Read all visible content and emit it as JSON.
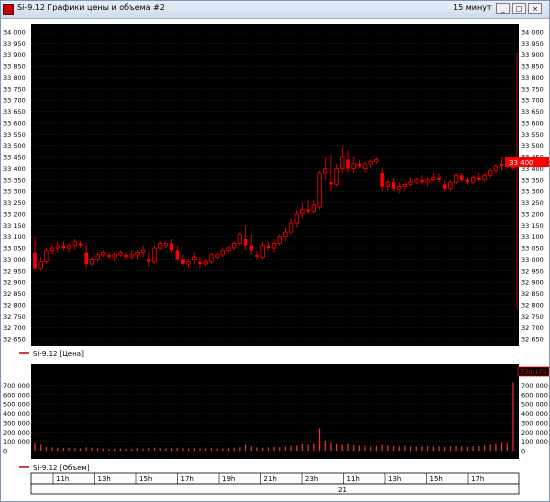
{
  "window": {
    "title": "Si-9.12 Графики цены и объема #2",
    "timeframe": "15 минут",
    "buttons": {
      "minimize": "_",
      "maximize": "□",
      "close": "×"
    }
  },
  "colors": {
    "background": "#000000",
    "candle": "#ff0000",
    "volume": "#ff3030",
    "grid": "#404040"
  },
  "legends": {
    "price": "Si-9.12 [Цена]",
    "volume": "Si-9.12 [Объем]"
  },
  "last_price_tag": "33 400",
  "last_volume_tag": "730 175",
  "time_axis": {
    "labels": [
      "11h",
      "13h",
      "15h",
      "17h",
      "19h",
      "21h",
      "23h",
      "11h",
      "13h",
      "15h",
      "17h"
    ],
    "date_label": "21"
  },
  "chart_data": [
    {
      "type": "candlestick",
      "series_name": "Si-9.12 [Цена]",
      "ylim": [
        32650,
        34000
      ],
      "y_ticks": [
        "34 000",
        "33 950",
        "33 900",
        "33 850",
        "33 800",
        "33 750",
        "33 700",
        "33 650",
        "33 600",
        "33 550",
        "33 500",
        "33 450",
        "33 400",
        "33 350",
        "33 300",
        "33 250",
        "33 200",
        "33 150",
        "33 100",
        "33 050",
        "33 000",
        "32 950",
        "32 900",
        "32 850",
        "32 800",
        "32 750",
        "32 700",
        "32 650"
      ],
      "ohlc": [
        [
          33030,
          33100,
          32955,
          32960
        ],
        [
          32960,
          33010,
          32950,
          32990
        ],
        [
          32990,
          33050,
          32980,
          33040
        ],
        [
          33040,
          33070,
          33020,
          33050
        ],
        [
          33050,
          33080,
          33030,
          33060
        ],
        [
          33060,
          33080,
          33040,
          33050
        ],
        [
          33050,
          33070,
          33030,
          33060
        ],
        [
          33060,
          33090,
          33040,
          33080
        ],
        [
          33070,
          33080,
          33050,
          33060
        ],
        [
          33030,
          33060,
          32960,
          32980
        ],
        [
          32980,
          33010,
          32970,
          33000
        ],
        [
          33000,
          33030,
          32990,
          33020
        ],
        [
          33020,
          33040,
          33010,
          33030
        ],
        [
          33020,
          33030,
          33000,
          33010
        ],
        [
          33010,
          33030,
          32990,
          33020
        ],
        [
          33020,
          33040,
          33010,
          33030
        ],
        [
          33020,
          33030,
          33000,
          33010
        ],
        [
          33010,
          33040,
          33000,
          33020
        ],
        [
          33020,
          33040,
          33000,
          33030
        ],
        [
          33030,
          33060,
          33010,
          33040
        ],
        [
          33000,
          33030,
          32970,
          32990
        ],
        [
          32990,
          33060,
          32980,
          33050
        ],
        [
          33050,
          33080,
          33040,
          33070
        ],
        [
          33060,
          33080,
          33050,
          33070
        ],
        [
          33070,
          33090,
          33030,
          33040
        ],
        [
          33040,
          33060,
          32990,
          33000
        ],
        [
          33000,
          33020,
          32970,
          32980
        ],
        [
          32980,
          33000,
          32960,
          32990
        ],
        [
          33000,
          33030,
          32980,
          33010
        ],
        [
          32990,
          33010,
          32960,
          32980
        ],
        [
          32980,
          33000,
          32970,
          32990
        ],
        [
          32990,
          33030,
          32980,
          33020
        ],
        [
          33010,
          33030,
          33000,
          33020
        ],
        [
          33020,
          33050,
          33010,
          33040
        ],
        [
          33040,
          33060,
          33030,
          33050
        ],
        [
          33050,
          33080,
          33040,
          33070
        ],
        [
          33070,
          33120,
          33060,
          33110
        ],
        [
          33090,
          33150,
          33040,
          33060
        ],
        [
          33060,
          33110,
          33020,
          33040
        ],
        [
          33020,
          33040,
          33000,
          33010
        ],
        [
          33010,
          33080,
          33000,
          33060
        ],
        [
          33060,
          33080,
          33040,
          33050
        ],
        [
          33050,
          33090,
          33030,
          33070
        ],
        [
          33070,
          33110,
          33060,
          33100
        ],
        [
          33100,
          33140,
          33080,
          33120
        ],
        [
          33120,
          33180,
          33110,
          33160
        ],
        [
          33160,
          33220,
          33140,
          33200
        ],
        [
          33200,
          33250,
          33180,
          33220
        ],
        [
          33220,
          33260,
          33200,
          33210
        ],
        [
          33210,
          33260,
          33200,
          33240
        ],
        [
          33230,
          33390,
          33220,
          33380
        ],
        [
          33380,
          33450,
          33350,
          33400
        ],
        [
          33340,
          33460,
          33300,
          33330
        ],
        [
          33330,
          33420,
          33320,
          33400
        ],
        [
          33400,
          33500,
          33380,
          33450
        ],
        [
          33440,
          33480,
          33380,
          33400
        ],
        [
          33400,
          33450,
          33380,
          33420
        ],
        [
          33420,
          33440,
          33400,
          33410
        ],
        [
          33400,
          33430,
          33380,
          33420
        ],
        [
          33420,
          33440,
          33400,
          33430
        ],
        [
          33430,
          33450,
          33420,
          33440
        ],
        [
          33380,
          33400,
          33300,
          33320
        ],
        [
          33320,
          33350,
          33300,
          33340
        ],
        [
          33340,
          33360,
          33300,
          33310
        ],
        [
          33310,
          33340,
          33290,
          33320
        ],
        [
          33320,
          33340,
          33300,
          33330
        ],
        [
          33330,
          33360,
          33320,
          33340
        ],
        [
          33340,
          33360,
          33330,
          33350
        ],
        [
          33350,
          33370,
          33330,
          33340
        ],
        [
          33340,
          33360,
          33320,
          33350
        ],
        [
          33350,
          33380,
          33340,
          33360
        ],
        [
          33360,
          33380,
          33340,
          33350
        ],
        [
          33330,
          33350,
          33300,
          33310
        ],
        [
          33310,
          33350,
          33300,
          33340
        ],
        [
          33340,
          33380,
          33330,
          33370
        ],
        [
          33370,
          33380,
          33340,
          33350
        ],
        [
          33350,
          33360,
          33330,
          33340
        ],
        [
          33340,
          33370,
          33330,
          33360
        ],
        [
          33360,
          33380,
          33340,
          33350
        ],
        [
          33350,
          33380,
          33340,
          33370
        ],
        [
          33370,
          33400,
          33360,
          33390
        ],
        [
          33390,
          33420,
          33380,
          33410
        ],
        [
          33420,
          33450,
          33390,
          33410
        ],
        [
          33410,
          33450,
          33400,
          33440
        ],
        [
          33440,
          33450,
          33390,
          33400
        ]
      ]
    },
    {
      "type": "bar",
      "series_name": "Si-9.12 [Объем]",
      "ylim": [
        0,
        800000
      ],
      "y_ticks": [
        "700 000",
        "600 000",
        "500 000",
        "400 000",
        "300 000",
        "200 000",
        "100 000",
        "0"
      ],
      "values": [
        90000,
        70000,
        45000,
        40000,
        35000,
        30000,
        35000,
        30000,
        28000,
        40000,
        35000,
        30000,
        25000,
        20000,
        22000,
        25000,
        20000,
        22000,
        30000,
        25000,
        30000,
        35000,
        30000,
        28000,
        30000,
        32000,
        28000,
        25000,
        30000,
        28000,
        25000,
        30000,
        25000,
        28000,
        30000,
        35000,
        40000,
        70000,
        50000,
        40000,
        35000,
        40000,
        45000,
        40000,
        50000,
        55000,
        60000,
        75000,
        70000,
        80000,
        240000,
        110000,
        90000,
        75000,
        70000,
        80000,
        65000,
        60000,
        55000,
        50000,
        55000,
        70000,
        60000,
        55000,
        50000,
        55000,
        50000,
        45000,
        50000,
        55000,
        48000,
        50000,
        45000,
        50000,
        55000,
        50000,
        45000,
        50000,
        55000,
        60000,
        70000,
        80000,
        90000,
        85000,
        730175
      ]
    }
  ]
}
